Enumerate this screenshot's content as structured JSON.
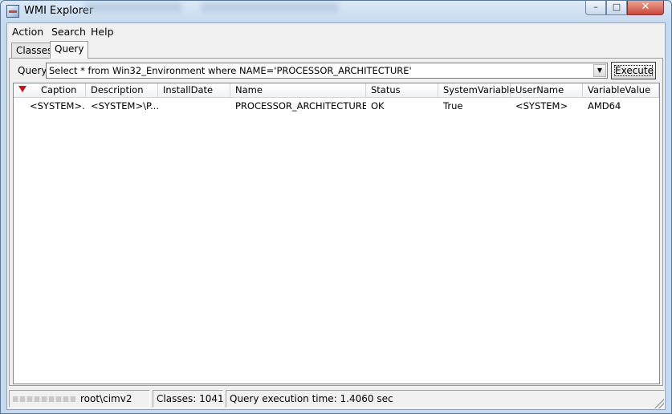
{
  "window": {
    "title": "WMI Explorer",
    "minimize": "–",
    "maximize": "□",
    "close": "✕"
  },
  "menu": [
    "Action",
    "Search",
    "Help"
  ],
  "tabs": [
    {
      "label": "Classes",
      "active": false
    },
    {
      "label": "Query",
      "active": true
    }
  ],
  "query": {
    "label": "Query",
    "value": "Select * from Win32_Environment where NAME='PROCESSOR_ARCHITECTURE'",
    "dropdown_icon": "▼",
    "execute_label": "Execute"
  },
  "grid": {
    "sort_icon": "sort-descending-icon",
    "columns": [
      "Caption",
      "Description",
      "InstallDate",
      "Name",
      "Status",
      "SystemVariable",
      "UserName",
      "VariableValue"
    ],
    "rows": [
      [
        "<SYSTEM>...",
        "<SYSTEM>\\P...",
        "",
        "PROCESSOR_ARCHITECTURE",
        "OK",
        "True",
        "<SYSTEM>",
        "AMD64"
      ]
    ]
  },
  "status": {
    "namespace": "root\\cimv2",
    "classes": "Classes: 1041",
    "execution_time": "Query execution time: 1.4060 sec"
  },
  "colors": {
    "sort_arrow": "#c0181a",
    "close_button": "#c9483a",
    "title_bar": "#c6d9ee"
  }
}
